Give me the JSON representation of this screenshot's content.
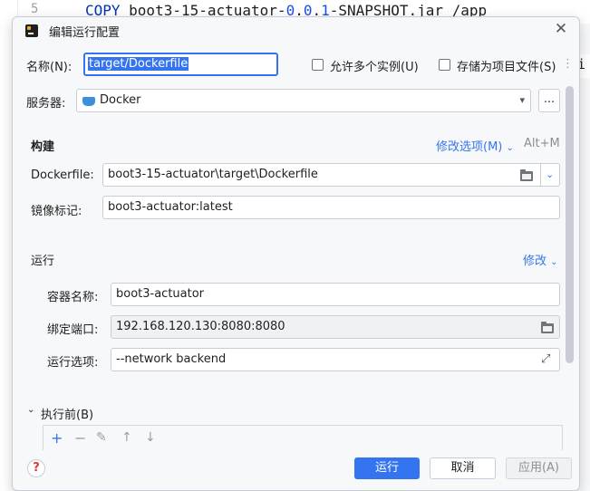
{
  "editor": {
    "line_number": "5",
    "code_keyword": "COPY",
    "code_pre": " boot3-15-actuator-",
    "code_version_a": "0",
    "code_dot1": ".",
    "code_version_b": "0",
    "code_dot2": ".",
    "code_version_c": "1",
    "code_post": "-SNAPSHOT.jar /app",
    "right_glyph": "i"
  },
  "dialog": {
    "title": "编辑运行配置",
    "close_glyph": "✕",
    "name_label": "名称(N):",
    "name_value": "target/Dockerfile",
    "allow_multiple_label": "允许多个实例(U)",
    "store_as_file_label": "存储为项目文件(S)",
    "more_glyph": "⋮",
    "server_label": "服务器:",
    "server_value": "Docker",
    "more_button": "...",
    "build_section": "构建",
    "modify_options": "修改选项(M)",
    "modify_shortcut": "Alt+M",
    "dockerfile_label": "Dockerfile:",
    "dockerfile_value": "boot3-15-actuator\\target\\Dockerfile",
    "image_tag_label": "镜像标记:",
    "image_tag_value": "boot3-actuator:latest",
    "run_section": "运行",
    "modify_link": "修改",
    "container_name_label": "容器名称:",
    "container_name_value": "boot3-actuator",
    "bind_ports_label": "绑定端口:",
    "bind_ports_value": "192.168.120.130:8080:8080",
    "run_options_label": "运行选项:",
    "run_options_value": "--network backend",
    "before_launch_label": "执行前(B)",
    "toolbar": {
      "add": "+",
      "remove": "−",
      "edit": "✎",
      "up": "↑",
      "down": "↓"
    },
    "help_glyph": "?",
    "run_button": "运行",
    "cancel_button": "取消",
    "apply_button": "应用(A)"
  },
  "colors": {
    "accent": "#3574f0",
    "background": "#f7f8fa",
    "border": "#c9ccd6"
  },
  "icons": {
    "folder": "folder-icon",
    "docker": "docker-icon",
    "expand": "expand-icon",
    "chevron": "chevron-down-icon"
  }
}
